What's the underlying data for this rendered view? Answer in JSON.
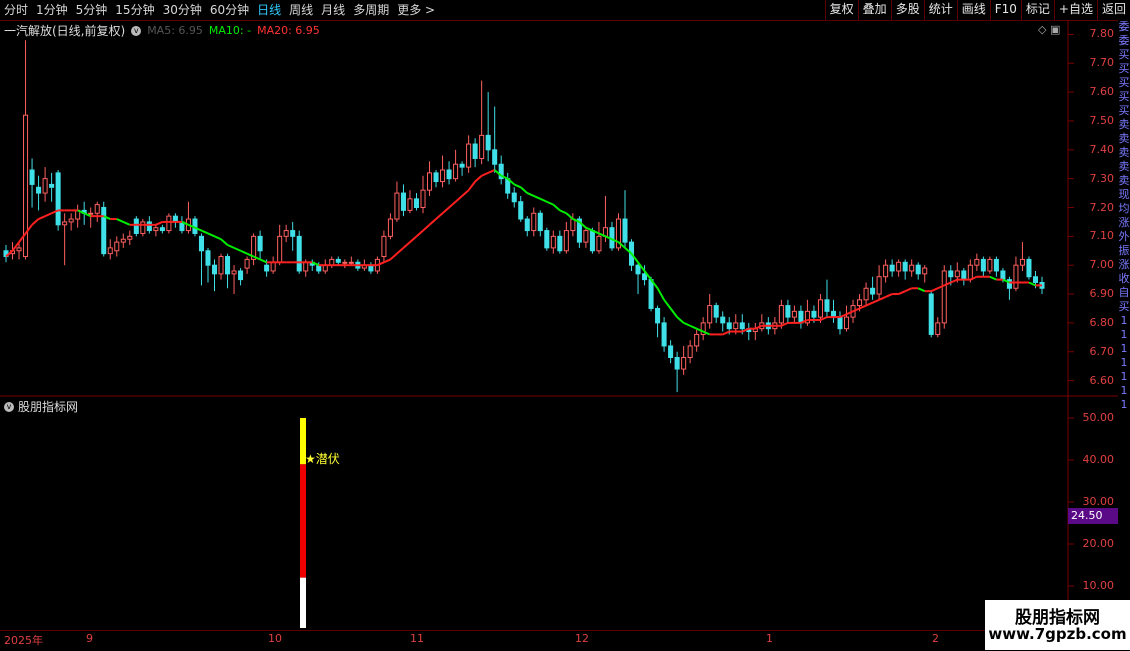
{
  "toolbar": {
    "tabs": [
      "分时",
      "1分钟",
      "5分钟",
      "15分钟",
      "30分钟",
      "60分钟",
      "日线",
      "周线",
      "月线",
      "多周期",
      "更多 >"
    ],
    "active_tab": "日线",
    "buttons": [
      "复权",
      "叠加",
      "多股",
      "统计",
      "画线",
      "F10",
      "标记",
      "+自选",
      "返回"
    ]
  },
  "main_chart": {
    "stock_name": "一汽解放(日线,前复权)",
    "ma5": "MA5: 6.95",
    "ma10": "MA10: -",
    "ma20": "MA20: 6.95",
    "y_labels": [
      "7.80",
      "7.70",
      "7.60",
      "7.50",
      "7.40",
      "7.30",
      "7.20",
      "7.10",
      "7.00",
      "6.90",
      "6.80",
      "6.70",
      "6.60"
    ]
  },
  "indicator": {
    "name": "股朋指标网",
    "signal_label": "★潜伏",
    "y_labels": [
      "50.00",
      "40.00",
      "30.00",
      "20.00",
      "10.00"
    ],
    "current_value": "24.50"
  },
  "dates": [
    "2025年",
    "9",
    "10",
    "11",
    "12",
    "1",
    "2"
  ],
  "side_text": [
    "委",
    "委",
    "买",
    "买",
    "买",
    "买",
    "买",
    "卖",
    "卖",
    "卖",
    "卖",
    "卖",
    "现",
    "均",
    "涨",
    "外",
    "振",
    "涨",
    "收",
    "自",
    "买",
    "1",
    "1",
    "1",
    "1",
    "1",
    "1",
    "1"
  ],
  "watermark": {
    "line1": "股朋指标网",
    "line2": "www.7gpzb.com"
  },
  "colors": {
    "up": "#ff6060",
    "down": "#40e0e8",
    "ma_up": "#ff2020",
    "ma_down": "#00ee00",
    "grid": "#7a0000"
  },
  "chart_data": {
    "type": "candlestick",
    "candles": [
      [
        7.05,
        7.03,
        7.07,
        7.01
      ],
      [
        7.04,
        7.05,
        7.08,
        7.02
      ],
      [
        7.05,
        7.06,
        7.08,
        7.02
      ],
      [
        7.03,
        7.52,
        7.78,
        7.02
      ],
      [
        7.33,
        7.28,
        7.37,
        7.2
      ],
      [
        7.27,
        7.25,
        7.31,
        7.19
      ],
      [
        7.25,
        7.3,
        7.34,
        7.22
      ],
      [
        7.28,
        7.27,
        7.32,
        7.22
      ],
      [
        7.32,
        7.14,
        7.33,
        7.12
      ],
      [
        7.14,
        7.15,
        7.18,
        7.0
      ],
      [
        7.15,
        7.16,
        7.18,
        7.12
      ],
      [
        7.16,
        7.19,
        7.21,
        7.13
      ],
      [
        7.19,
        7.18,
        7.22,
        7.14
      ],
      [
        7.18,
        7.18,
        7.2,
        7.13
      ],
      [
        7.18,
        7.21,
        7.22,
        7.15
      ],
      [
        7.2,
        7.04,
        7.22,
        7.03
      ],
      [
        7.04,
        7.06,
        7.09,
        7.02
      ],
      [
        7.05,
        7.08,
        7.1,
        7.03
      ],
      [
        7.08,
        7.09,
        7.11,
        7.06
      ],
      [
        7.09,
        7.1,
        7.12,
        7.07
      ],
      [
        7.16,
        7.11,
        7.17,
        7.1
      ],
      [
        7.11,
        7.15,
        7.16,
        7.1
      ],
      [
        7.15,
        7.12,
        7.17,
        7.11
      ],
      [
        7.12,
        7.13,
        7.14,
        7.1
      ],
      [
        7.13,
        7.12,
        7.14,
        7.11
      ],
      [
        7.12,
        7.17,
        7.18,
        7.11
      ],
      [
        7.17,
        7.15,
        7.18,
        7.13
      ],
      [
        7.15,
        7.12,
        7.17,
        7.11
      ],
      [
        7.12,
        7.16,
        7.22,
        7.11
      ],
      [
        7.16,
        7.11,
        7.17,
        7.1
      ],
      [
        7.1,
        7.05,
        7.11,
        6.93
      ],
      [
        7.05,
        7.0,
        7.06,
        6.94
      ],
      [
        7.0,
        6.97,
        7.02,
        6.91
      ],
      [
        6.97,
        7.03,
        7.04,
        6.95
      ],
      [
        7.03,
        6.97,
        7.04,
        6.92
      ],
      [
        6.97,
        6.98,
        7.0,
        6.9
      ],
      [
        6.98,
        6.95,
        6.99,
        6.93
      ],
      [
        6.99,
        7.02,
        7.03,
        6.97
      ],
      [
        7.02,
        7.1,
        7.11,
        7.0
      ],
      [
        7.1,
        7.05,
        7.12,
        7.02
      ],
      [
        7.0,
        6.98,
        7.02,
        6.96
      ],
      [
        6.98,
        7.01,
        7.03,
        6.97
      ],
      [
        7.01,
        7.1,
        7.14,
        7.0
      ],
      [
        7.1,
        7.12,
        7.14,
        7.08
      ],
      [
        7.12,
        7.1,
        7.15,
        7.05
      ],
      [
        7.1,
        6.98,
        7.12,
        6.97
      ],
      [
        6.98,
        7.01,
        7.02,
        6.96
      ],
      [
        7.01,
        7.0,
        7.02,
        6.98
      ],
      [
        7.0,
        6.98,
        7.01,
        6.97
      ],
      [
        6.98,
        7.0,
        7.02,
        6.97
      ],
      [
        7.0,
        7.02,
        7.03,
        6.99
      ],
      [
        7.02,
        7.01,
        7.03,
        7.0
      ],
      [
        7.01,
        7.01,
        7.02,
        6.99
      ],
      [
        7.01,
        7.01,
        7.03,
        7.0
      ],
      [
        7.01,
        6.99,
        7.02,
        6.98
      ],
      [
        6.99,
        7.0,
        7.02,
        6.98
      ],
      [
        7.0,
        6.98,
        7.01,
        6.97
      ],
      [
        6.98,
        7.02,
        7.03,
        6.97
      ],
      [
        7.03,
        7.1,
        7.12,
        7.01
      ],
      [
        7.1,
        7.16,
        7.18,
        7.09
      ],
      [
        7.16,
        7.25,
        7.29,
        7.15
      ],
      [
        7.25,
        7.19,
        7.28,
        7.17
      ],
      [
        7.19,
        7.23,
        7.26,
        7.18
      ],
      [
        7.23,
        7.2,
        7.25,
        7.19
      ],
      [
        7.2,
        7.26,
        7.31,
        7.18
      ],
      [
        7.26,
        7.32,
        7.36,
        7.24
      ],
      [
        7.32,
        7.29,
        7.33,
        7.27
      ],
      [
        7.29,
        7.33,
        7.38,
        7.27
      ],
      [
        7.33,
        7.3,
        7.36,
        7.28
      ],
      [
        7.3,
        7.35,
        7.4,
        7.29
      ],
      [
        7.35,
        7.34,
        7.36,
        7.31
      ],
      [
        7.34,
        7.42,
        7.45,
        7.32
      ],
      [
        7.42,
        7.37,
        7.44,
        7.34
      ],
      [
        7.37,
        7.45,
        7.64,
        7.35
      ],
      [
        7.45,
        7.4,
        7.6,
        7.36
      ],
      [
        7.4,
        7.35,
        7.55,
        7.32
      ],
      [
        7.35,
        7.3,
        7.38,
        7.28
      ],
      [
        7.3,
        7.25,
        7.32,
        7.23
      ],
      [
        7.25,
        7.22,
        7.27,
        7.2
      ],
      [
        7.22,
        7.16,
        7.24,
        7.15
      ],
      [
        7.16,
        7.12,
        7.17,
        7.1
      ],
      [
        7.12,
        7.18,
        7.2,
        7.1
      ],
      [
        7.18,
        7.12,
        7.19,
        7.1
      ],
      [
        7.12,
        7.06,
        7.13,
        7.05
      ],
      [
        7.06,
        7.1,
        7.12,
        7.04
      ],
      [
        7.1,
        7.05,
        7.12,
        7.04
      ],
      [
        7.05,
        7.12,
        7.15,
        7.04
      ],
      [
        7.12,
        7.16,
        7.18,
        7.1
      ],
      [
        7.16,
        7.08,
        7.17,
        7.06
      ],
      [
        7.08,
        7.12,
        7.13,
        7.06
      ],
      [
        7.12,
        7.05,
        7.13,
        7.04
      ],
      [
        7.05,
        7.1,
        7.15,
        7.04
      ],
      [
        7.1,
        7.13,
        7.24,
        7.08
      ],
      [
        7.13,
        7.06,
        7.15,
        7.05
      ],
      [
        7.06,
        7.16,
        7.18,
        7.05
      ],
      [
        7.16,
        7.08,
        7.26,
        7.06
      ],
      [
        7.08,
        7.0,
        7.09,
        6.98
      ],
      [
        7.0,
        6.97,
        7.01,
        6.9
      ],
      [
        6.97,
        6.95,
        7.0,
        6.93
      ],
      [
        6.95,
        6.85,
        6.96,
        6.84
      ],
      [
        6.85,
        6.8,
        6.86,
        6.75
      ],
      [
        6.8,
        6.72,
        6.82,
        6.7
      ],
      [
        6.72,
        6.68,
        6.74,
        6.66
      ],
      [
        6.68,
        6.64,
        6.7,
        6.56
      ],
      [
        6.64,
        6.68,
        6.72,
        6.62
      ],
      [
        6.68,
        6.72,
        6.74,
        6.66
      ],
      [
        6.72,
        6.76,
        6.78,
        6.7
      ],
      [
        6.76,
        6.8,
        6.82,
        6.74
      ],
      [
        6.8,
        6.86,
        6.9,
        6.78
      ],
      [
        6.86,
        6.82,
        6.87,
        6.8
      ],
      [
        6.82,
        6.8,
        6.84,
        6.77
      ],
      [
        6.8,
        6.78,
        6.82,
        6.76
      ],
      [
        6.78,
        6.8,
        6.83,
        6.76
      ],
      [
        6.8,
        6.78,
        6.83,
        6.76
      ],
      [
        6.78,
        6.77,
        6.8,
        6.74
      ],
      [
        6.77,
        6.78,
        6.8,
        6.74
      ],
      [
        6.78,
        6.8,
        6.83,
        6.77
      ],
      [
        6.8,
        6.78,
        6.82,
        6.76
      ],
      [
        6.78,
        6.8,
        6.82,
        6.76
      ],
      [
        6.8,
        6.86,
        6.88,
        6.78
      ],
      [
        6.86,
        6.82,
        6.88,
        6.8
      ],
      [
        6.82,
        6.84,
        6.86,
        6.8
      ],
      [
        6.84,
        6.8,
        6.86,
        6.78
      ],
      [
        6.8,
        6.84,
        6.88,
        6.79
      ],
      [
        6.84,
        6.82,
        6.86,
        6.8
      ],
      [
        6.82,
        6.88,
        6.9,
        6.8
      ],
      [
        6.88,
        6.84,
        6.95,
        6.82
      ],
      [
        6.84,
        6.82,
        6.88,
        6.8
      ],
      [
        6.82,
        6.78,
        6.84,
        6.76
      ],
      [
        6.78,
        6.82,
        6.86,
        6.77
      ],
      [
        6.82,
        6.86,
        6.88,
        6.8
      ],
      [
        6.86,
        6.88,
        6.9,
        6.84
      ],
      [
        6.88,
        6.92,
        6.94,
        6.86
      ],
      [
        6.92,
        6.9,
        6.96,
        6.88
      ],
      [
        6.9,
        6.96,
        7.0,
        6.88
      ],
      [
        6.96,
        7.0,
        7.02,
        6.94
      ],
      [
        7.0,
        6.98,
        7.02,
        6.96
      ],
      [
        6.98,
        7.01,
        7.02,
        6.96
      ],
      [
        7.01,
        6.98,
        7.02,
        6.95
      ],
      [
        6.98,
        7.0,
        7.02,
        6.96
      ],
      [
        7.0,
        6.97,
        7.01,
        6.95
      ],
      [
        6.97,
        6.99,
        7.0,
        6.94
      ],
      [
        6.9,
        6.76,
        6.91,
        6.75
      ],
      [
        6.76,
        6.8,
        6.82,
        6.75
      ],
      [
        6.8,
        6.98,
        7.0,
        6.78
      ],
      [
        6.98,
        6.96,
        7.0,
        6.93
      ],
      [
        6.96,
        6.98,
        7.01,
        6.94
      ],
      [
        6.98,
        6.95,
        6.99,
        6.93
      ],
      [
        6.95,
        7.0,
        7.02,
        6.94
      ],
      [
        7.0,
        7.02,
        7.04,
        6.98
      ],
      [
        7.02,
        6.98,
        7.03,
        6.96
      ],
      [
        6.98,
        7.02,
        7.03,
        6.97
      ],
      [
        7.02,
        6.98,
        7.03,
        6.96
      ],
      [
        6.98,
        6.95,
        6.99,
        6.94
      ],
      [
        6.95,
        6.92,
        6.96,
        6.88
      ],
      [
        6.92,
        7.0,
        7.03,
        6.91
      ],
      [
        7.0,
        7.02,
        7.08,
        6.98
      ],
      [
        7.02,
        6.96,
        7.03,
        6.95
      ],
      [
        6.96,
        6.94,
        6.98,
        6.92
      ],
      [
        6.94,
        6.92,
        6.96,
        6.9
      ]
    ],
    "ma_line": [
      7.03,
      7.05,
      7.08,
      7.11,
      7.14,
      7.16,
      7.17,
      7.18,
      7.19,
      7.19,
      7.19,
      7.19,
      7.18,
      7.17,
      7.17,
      7.17,
      7.16,
      7.16,
      7.15,
      7.14,
      7.14,
      7.14,
      7.14,
      7.14,
      7.15,
      7.15,
      7.15,
      7.15,
      7.14,
      7.13,
      7.12,
      7.11,
      7.1,
      7.09,
      7.07,
      7.06,
      7.05,
      7.04,
      7.03,
      7.02,
      7.01,
      7.01,
      7.01,
      7.01,
      7.01,
      7.01,
      7.01,
      7.01,
      7.0,
      7.0,
      7.0,
      7.0,
      7.0,
      7.0,
      7.0,
      7.0,
      7.0,
      7.0,
      7.01,
      7.02,
      7.04,
      7.06,
      7.08,
      7.1,
      7.12,
      7.14,
      7.16,
      7.18,
      7.2,
      7.22,
      7.24,
      7.26,
      7.29,
      7.31,
      7.32,
      7.33,
      7.31,
      7.3,
      7.28,
      7.27,
      7.25,
      7.24,
      7.23,
      7.22,
      7.21,
      7.19,
      7.18,
      7.16,
      7.15,
      7.13,
      7.12,
      7.11,
      7.1,
      7.09,
      7.08,
      7.06,
      7.04,
      7.01,
      6.98,
      6.95,
      6.92,
      6.88,
      6.85,
      6.82,
      6.8,
      6.79,
      6.78,
      6.77,
      6.76,
      6.76,
      6.76,
      6.77,
      6.77,
      6.77,
      6.78,
      6.78,
      6.79,
      6.79,
      6.79,
      6.79,
      6.8,
      6.8,
      6.8,
      6.81,
      6.81,
      6.81,
      6.82,
      6.82,
      6.82,
      6.83,
      6.84,
      6.85,
      6.86,
      6.87,
      6.88,
      6.89,
      6.9,
      6.9,
      6.91,
      6.92,
      6.92,
      6.91,
      6.91,
      6.92,
      6.93,
      6.94,
      6.95,
      6.95,
      6.95,
      6.96,
      6.96,
      6.96,
      6.95,
      6.95,
      6.94,
      6.94,
      6.94,
      6.94,
      6.93,
      6.93
    ],
    "signal": {
      "bar_index": 0,
      "value_ranges": [
        [
          0,
          12
        ],
        [
          12,
          39
        ],
        [
          39,
          50
        ]
      ],
      "colors": [
        "white",
        "red",
        "yellow"
      ]
    },
    "price_ylim": [
      6.55,
      7.85
    ],
    "indicator_ylim": [
      0,
      55
    ]
  }
}
